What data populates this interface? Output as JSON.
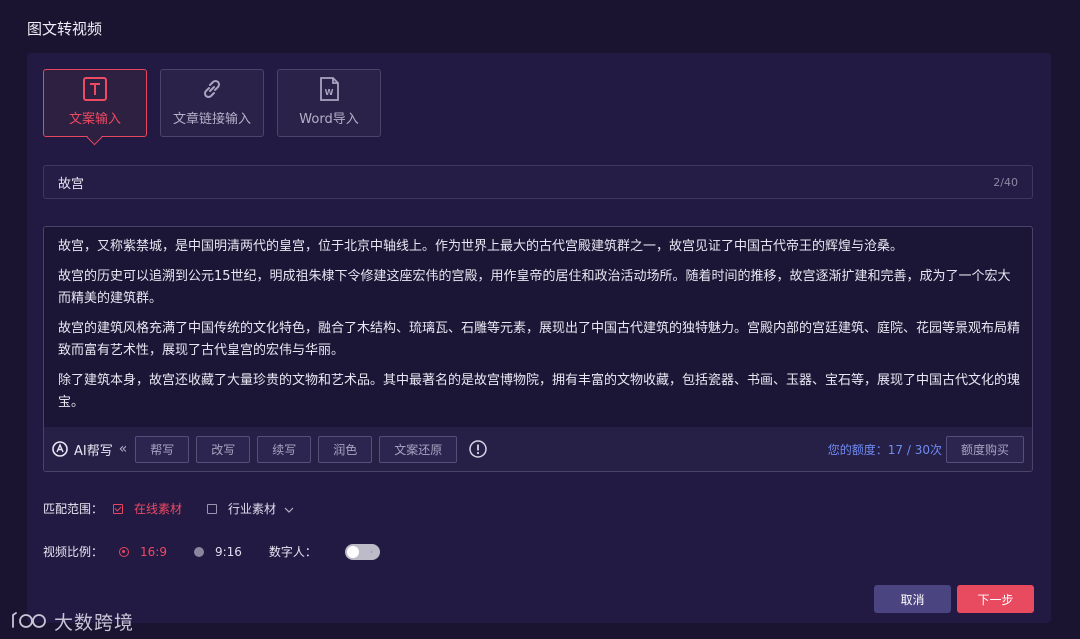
{
  "page_title": "图文转视频",
  "mode_tabs": [
    {
      "label": "文案输入",
      "icon": "text-t-icon",
      "active": true
    },
    {
      "label": "文章链接输入",
      "icon": "link-icon",
      "active": false
    },
    {
      "label": "Word导入",
      "icon": "word-file-icon",
      "active": false
    }
  ],
  "title_field": {
    "value": "故宫",
    "counter": "2/40"
  },
  "content": {
    "paragraphs": [
      "故宫，又称紫禁城，是中国明清两代的皇宫，位于北京中轴线上。作为世界上最大的古代宫殿建筑群之一，故宫见证了中国古代帝王的辉煌与沧桑。",
      "故宫的历史可以追溯到公元15世纪，明成祖朱棣下令修建这座宏伟的宫殿，用作皇帝的居住和政治活动场所。随着时间的推移，故宫逐渐扩建和完善，成为了一个宏大而精美的建筑群。",
      "故宫的建筑风格充满了中国传统的文化特色，融合了木结构、琉璃瓦、石雕等元素，展现出了中国古代建筑的独特魅力。宫殿内部的宫廷建筑、庭院、花园等景观布局精致而富有艺术性，展现了古代皇宫的宏伟与华丽。",
      "除了建筑本身，故宫还收藏了大量珍贵的文物和艺术品。其中最著名的是故宫博物院，拥有丰富的文物收藏，包括瓷器、书画、玉器、宝石等，展现了中国古代文化的瑰宝。"
    ]
  },
  "ai_bar": {
    "label": "AI帮写",
    "collapse": "«",
    "buttons": [
      "帮写",
      "改写",
      "续写",
      "润色",
      "文案还原"
    ],
    "quota": "您的额度：17 / 30次",
    "buy": "额度购买"
  },
  "match_range": {
    "label": "匹配范围：",
    "online": "在线素材",
    "industry": "行业素材"
  },
  "video_ratio": {
    "label": "视频比例：",
    "options": [
      "16:9",
      "9:16"
    ],
    "selected": "16:9",
    "digital_human_label": "数字人："
  },
  "footer": {
    "cancel": "取消",
    "next": "下一步"
  },
  "watermark": {
    "text": "大数跨境"
  },
  "colors": {
    "accent": "#e8455f",
    "background": "#1a1430",
    "panel": "#221a42",
    "quota_blue": "#6f8cf4"
  }
}
